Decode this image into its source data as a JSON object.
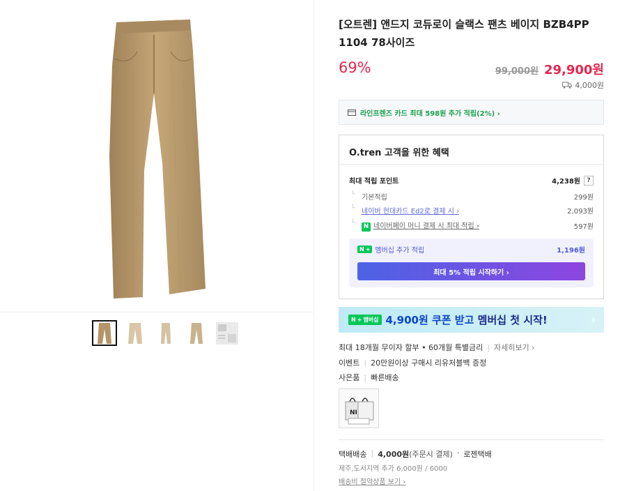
{
  "product": {
    "title": "[오트렌] 앤드지 코듀로이 슬랙스 팬츠 베이지 BZB4PP 1104 78사이즈",
    "discount": "69%",
    "original_price": "99,000원",
    "sale_price": "29,900원",
    "shipping_fee": "4,000원"
  },
  "card_promo": {
    "text": "라인프렌즈 카드 최대 598원 추가 적립(2%) ›"
  },
  "benefit": {
    "heading": "O.tren 고객을 위한 혜택",
    "max_point_label": "최대 적립 포인트",
    "max_point_value": "4,238원",
    "help": "?",
    "rows": [
      {
        "label": "기본적립",
        "value": "299원"
      },
      {
        "label": "네이버 현대카드 Ed2로 결제 시 ›",
        "value": "2,093원"
      },
      {
        "label": "네이버페이 머니 결제 시 최대 적립 ›",
        "value": "597원"
      }
    ],
    "membership_label": "멤버십 추가 적립",
    "membership_value": "1,196원",
    "membership_button": "최대 5% 적립 시작하기 ›",
    "naver_badge": "N",
    "plus_badge": "+"
  },
  "promo_banner": {
    "badge": "멤버십",
    "amount": "4,900원 쿠폰 받고",
    "rest": "멤버십 첫 시작!",
    "arrow": "›"
  },
  "installment": {
    "text": "최대 18개월 무이자 할부 • 60개월 특별금리",
    "link": "자세히보기 ›"
  },
  "event": {
    "label": "이벤트",
    "text": "20만원이상 구매시 리유저블백 증정"
  },
  "gift": {
    "label": "사은품",
    "text": "빠른배송"
  },
  "shipping": {
    "type": "택배배송",
    "fee": "4,000원",
    "fee_note": "(주문시 결제)",
    "carrier": "로젠택배",
    "extra": "제주,도서지역 추가 6,000원 / 6000",
    "link": "배송비 절약상품 보기 ›"
  },
  "colors": {
    "accent_red": "#e4264d",
    "naver_green": "#03c75a",
    "member_blue": "#4f5bd5"
  },
  "icons": [
    "truck-icon",
    "card-icon",
    "naver-n-icon",
    "chevron-right-icon"
  ]
}
